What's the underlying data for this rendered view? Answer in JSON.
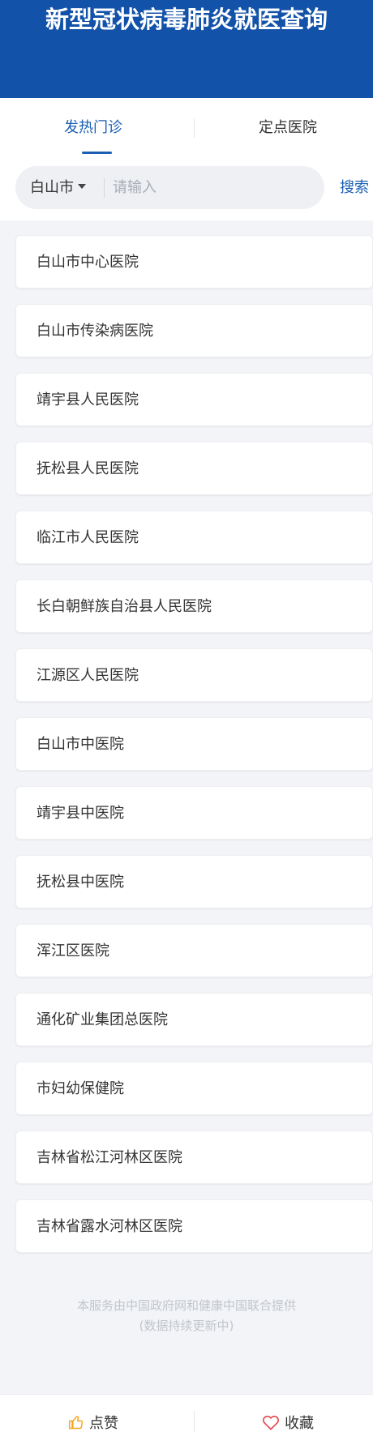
{
  "header": {
    "title": "新型冠状病毒肺炎就医查询"
  },
  "tabs": [
    {
      "label": "发热门诊",
      "active": true
    },
    {
      "label": "定点医院",
      "active": false
    }
  ],
  "search": {
    "city": "白山市",
    "placeholder": "请输入",
    "value": "",
    "button_label": "搜索"
  },
  "hospitals": [
    "白山市中心医院",
    "白山市传染病医院",
    "靖宇县人民医院",
    "抚松县人民医院",
    "临江市人民医院",
    "长白朝鲜族自治县人民医院",
    "江源区人民医院",
    "白山市中医院",
    "靖宇县中医院",
    "抚松县中医院",
    "浑江区医院",
    "通化矿业集团总医院",
    "市妇幼保健院",
    "吉林省松江河林区医院",
    "吉林省露水河林区医院"
  ],
  "footer": {
    "line1": "本服务由中国政府网和健康中国联合提供",
    "line2": "(数据持续更新中)"
  },
  "bottom_bar": {
    "like_label": "点赞",
    "like_icon": "thumbs-up-icon",
    "fav_label": "收藏",
    "fav_icon": "heart-icon"
  },
  "colors": {
    "header_bg": "#1252a8",
    "accent": "#1a5fb4",
    "like_icon": "#f5a623",
    "fav_icon": "#e5484d"
  }
}
